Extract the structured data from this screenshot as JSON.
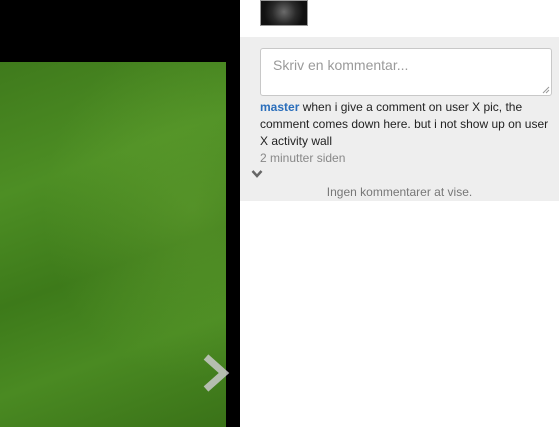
{
  "comment_box": {
    "placeholder": "Skriv en kommentar..."
  },
  "comments": [
    {
      "author": "master",
      "text": "when i give a comment on user X pic, the comment comes down here. but i not show up on user X activity wall",
      "timestamp": "2 minutter siden"
    }
  ],
  "empty_message": "Ingen kommentarer at vise.",
  "icons": {
    "next": "chevron-right-icon",
    "more": "chevron-down-icon",
    "resize": "resize-grip-icon"
  },
  "colors": {
    "author_link": "#2a6ebb",
    "panel_bg": "#eeeeee",
    "photo_green": "#4a8a22"
  }
}
